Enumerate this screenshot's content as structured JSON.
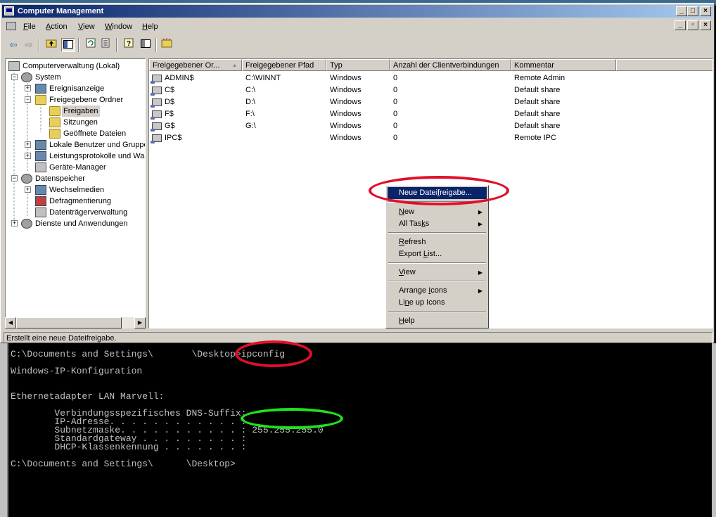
{
  "window": {
    "title": "Computer Management",
    "minimize": "_",
    "maximize": "□",
    "close": "×"
  },
  "menubar": {
    "items": [
      {
        "pre": "",
        "ul": "F",
        "post": "ile"
      },
      {
        "pre": "",
        "ul": "A",
        "post": "ction"
      },
      {
        "pre": "",
        "ul": "V",
        "post": "iew"
      },
      {
        "pre": "",
        "ul": "W",
        "post": "indow"
      },
      {
        "pre": "",
        "ul": "H",
        "post": "elp"
      }
    ],
    "mdi_min": "_",
    "mdi_restore": "▫",
    "mdi_close": "×"
  },
  "toolbar": {
    "icons": [
      "back-arrow-icon",
      "forward-arrow-icon",
      "up-folder-icon",
      "show-tree-icon",
      "refresh-icon",
      "export-list-icon",
      "help-icon",
      "properties-icon",
      "new-share-icon"
    ]
  },
  "tree": {
    "items": [
      {
        "label": "Computerverwaltung (Lokal)",
        "icon": "computer-management-icon"
      },
      {
        "label": "System",
        "icon": "system-tools-icon",
        "exp": "−"
      },
      {
        "label": "Ereignisanzeige",
        "icon": "event-viewer-icon",
        "exp": "+"
      },
      {
        "label": "Freigegebene Ordner",
        "icon": "shared-folders-icon",
        "exp": "−"
      },
      {
        "label": "Freigaben",
        "icon": "shares-folder-icon",
        "selected": true
      },
      {
        "label": "Sitzungen",
        "icon": "sessions-folder-icon"
      },
      {
        "label": "Geöffnete Dateien",
        "icon": "open-files-folder-icon"
      },
      {
        "label": "Lokale Benutzer und Gruppe",
        "icon": "local-users-icon",
        "exp": "+"
      },
      {
        "label": "Leistungsprotokolle und War",
        "icon": "performance-logs-icon",
        "exp": "+"
      },
      {
        "label": "Geräte-Manager",
        "icon": "device-manager-icon"
      },
      {
        "label": "Datenspeicher",
        "icon": "storage-icon",
        "exp": "−"
      },
      {
        "label": "Wechselmedien",
        "icon": "removable-storage-icon",
        "exp": "+"
      },
      {
        "label": "Defragmentierung",
        "icon": "defrag-icon"
      },
      {
        "label": "Datenträgerverwaltung",
        "icon": "disk-management-icon"
      },
      {
        "label": "Dienste und Anwendungen",
        "icon": "services-apps-icon",
        "exp": "+"
      }
    ]
  },
  "list": {
    "columns": [
      "Freigegebener Or...",
      "Freigegebener Pfad",
      "Typ",
      "Anzahl der Clientverbindungen",
      "Kommentar"
    ],
    "sort_indicator": "▲",
    "rows": [
      {
        "name": "ADMIN$",
        "path": "C:\\WINNT",
        "type": "Windows",
        "count": "0",
        "comment": "Remote Admin"
      },
      {
        "name": "C$",
        "path": "C:\\",
        "type": "Windows",
        "count": "0",
        "comment": "Default share"
      },
      {
        "name": "D$",
        "path": "D:\\",
        "type": "Windows",
        "count": "0",
        "comment": "Default share"
      },
      {
        "name": "F$",
        "path": "F:\\",
        "type": "Windows",
        "count": "0",
        "comment": "Default share"
      },
      {
        "name": "G$",
        "path": "G:\\",
        "type": "Windows",
        "count": "0",
        "comment": "Default share"
      },
      {
        "name": "IPC$",
        "path": "",
        "type": "Windows",
        "count": "0",
        "comment": "Remote IPC"
      }
    ]
  },
  "context_menu": {
    "items": [
      {
        "pre": "Neue Datei",
        "ul": "f",
        "post": "reigabe...",
        "highlighted": true
      },
      {
        "pre": "",
        "ul": "N",
        "post": "ew",
        "submenu": true
      },
      {
        "pre": "All Tas",
        "ul": "k",
        "post": "s",
        "submenu": true
      },
      {
        "pre": "",
        "ul": "R",
        "post": "efresh"
      },
      {
        "pre": "Export ",
        "ul": "L",
        "post": "ist..."
      },
      {
        "pre": "",
        "ul": "V",
        "post": "iew",
        "submenu": true
      },
      {
        "pre": "Arrange ",
        "ul": "I",
        "post": "cons",
        "submenu": true
      },
      {
        "pre": "Li",
        "ul": "n",
        "post": "e up Icons"
      },
      {
        "pre": "",
        "ul": "H",
        "post": "elp"
      }
    ],
    "arrow": "▶"
  },
  "statusbar": {
    "text": "Erstellt eine neue Dateifreigabe."
  },
  "console": {
    "lines": [
      "C:\\Documents and Settings\\       \\Desktop>ipconfig",
      "Windows-IP-Konfiguration",
      "Ethernetadapter LAN Marvell:",
      "        Verbindungsspezifisches DNS-Suffix:",
      "        IP-Adresse. . . . . . . . . . . . :",
      "        Subnetzmaske. . . . . . . . . . . : 255.255.255.0",
      "        Standardgateway . . . . . . . . . :",
      "        DHCP-Klassenkennung . . . . . . . :",
      "C:\\Documents and Settings\\      \\Desktop>"
    ]
  },
  "colors": {
    "annotation_red": "#e0102a",
    "annotation_green": "#1ee21e",
    "selection_blue": "#0a246a"
  }
}
